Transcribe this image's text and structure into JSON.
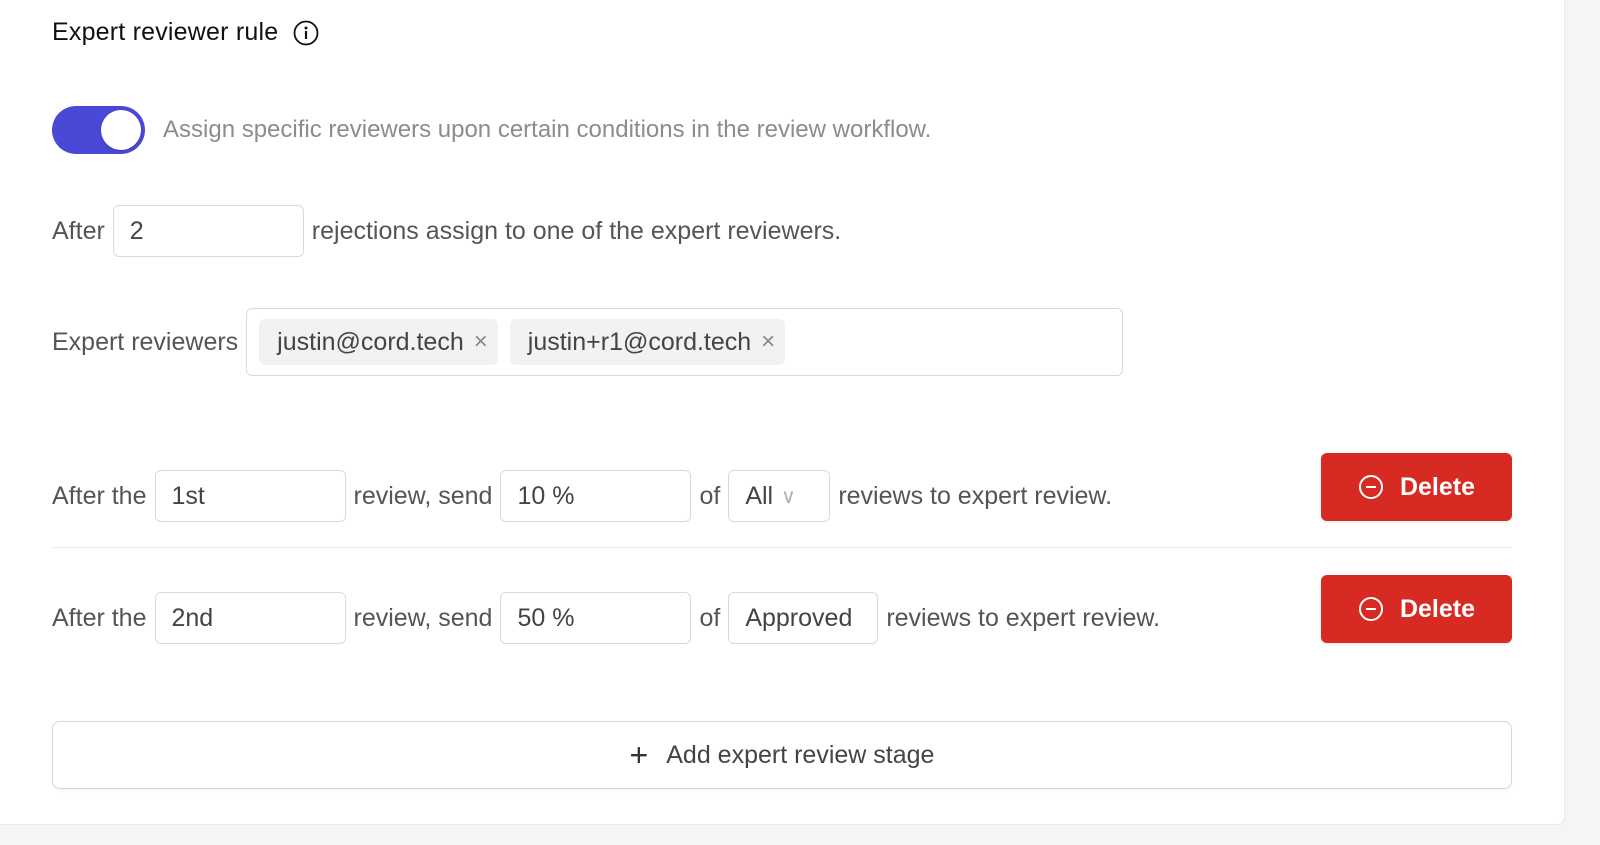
{
  "section": {
    "title": "Expert reviewer rule",
    "info_icon": "info-circle-icon"
  },
  "toggle": {
    "enabled": true,
    "description": "Assign specific reviewers upon certain conditions in the review workflow.",
    "accent_color": "#4a48d6"
  },
  "rejections": {
    "prefix": "After",
    "value": "2",
    "suffix": "rejections assign to one of the expert reviewers."
  },
  "reviewers": {
    "label": "Expert reviewers",
    "tags": [
      {
        "email": "justin@cord.tech",
        "remove": "×"
      },
      {
        "email": "justin+r1@cord.tech",
        "remove": "×"
      }
    ]
  },
  "stages": [
    {
      "prefix": "After the",
      "review_number": "1st",
      "middle": "review, send",
      "percent": "10 %",
      "of": "of",
      "filter": "All",
      "filter_caret": "∨",
      "suffix": "reviews to expert review.",
      "delete_label": "Delete"
    },
    {
      "prefix": "After the",
      "review_number": "2nd",
      "middle": "review, send",
      "percent": "50 %",
      "of": "of",
      "filter": "Approved",
      "suffix": "reviews to expert review.",
      "delete_label": "Delete"
    }
  ],
  "add_stage": {
    "icon": "+",
    "label": "Add expert review stage"
  },
  "colors": {
    "delete": "#d72a23",
    "toggle": "#4a48d6"
  }
}
